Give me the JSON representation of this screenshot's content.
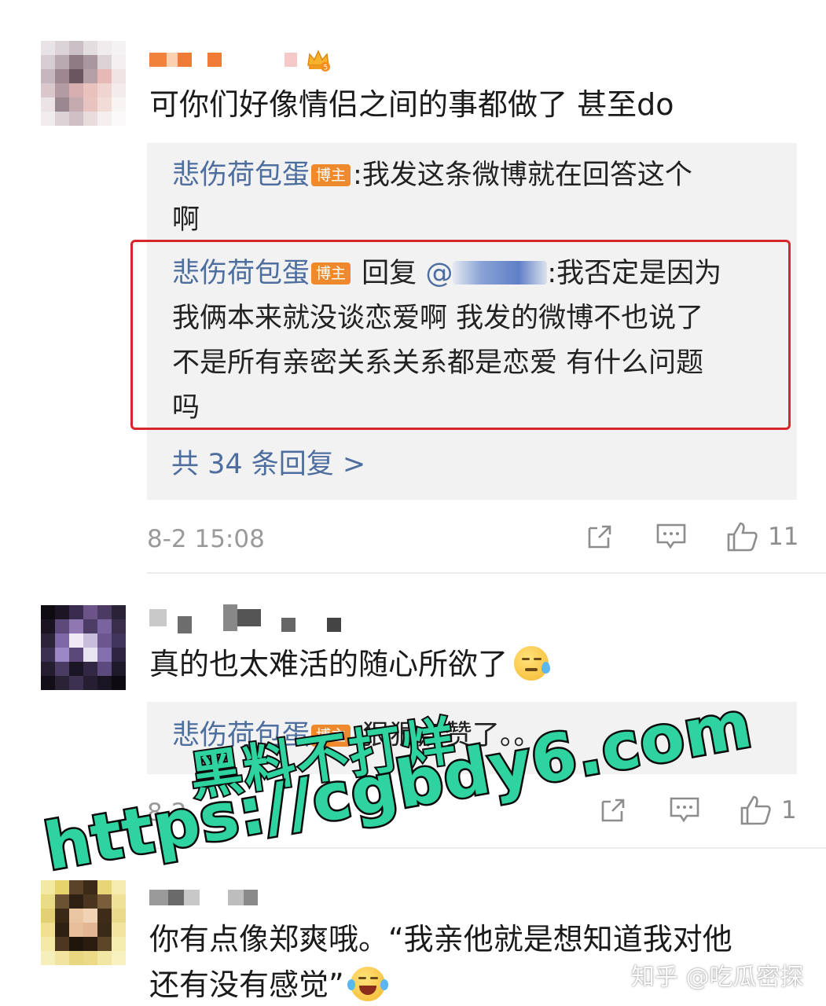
{
  "comments": [
    {
      "text": "可你们好像情侣之间的事都做了 甚至do",
      "replies": [
        {
          "author": "悲伤荷包蛋",
          "badge": "博主",
          "text": ":我发这条微博就在回答这个",
          "text_line2": "啊"
        },
        {
          "author": "悲伤荷包蛋",
          "badge": "博主",
          "reply_word": "回复",
          "at": "@",
          "text_line1": ":我否定是因为",
          "text_line2": "我俩本来就没谈恋爱啊 我发的微博不也说了",
          "text_line3": "不是所有亲密关系关系都是恋爱 有什么问题",
          "text_line4": "吗"
        }
      ],
      "more_replies": "共 34 条回复 >",
      "timestamp": "8-2 15:08",
      "like_count": "11"
    },
    {
      "text": "真的也太难活的随心所欲了",
      "emoji": "sleepy-sweat-emoji",
      "replies": [
        {
          "author": "悲伤荷包蛋",
          "badge": "博主",
          "text": ":狠狠点赞了。。"
        }
      ],
      "timestamp": "8-2",
      "like_count": "1"
    },
    {
      "text_line1": "你有点像郑爽哦。“我亲他就是想知道我对他",
      "text_line2": "还有没有感觉”",
      "emoji": "laugh-cry-emoji"
    }
  ],
  "watermark": {
    "line1": "黑料不打烊",
    "line2": "https://cgbdy6.com"
  },
  "credit": "知乎 @吃瓜密探",
  "colors": {
    "author_link": "#4d6e9e",
    "badge": "#ef8a2c",
    "highlight_frame": "#d6272b",
    "watermark_fill": "#2fd3a0",
    "reply_bg": "#f2f2f2",
    "meta_text": "#9a9a9a"
  },
  "icons": [
    "share-icon",
    "comment-icon",
    "like-icon",
    "crown-vip-icon"
  ]
}
